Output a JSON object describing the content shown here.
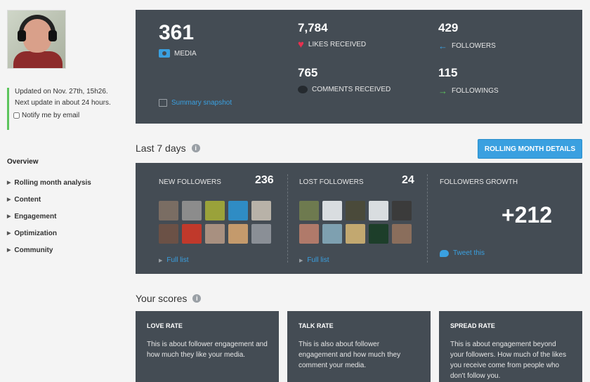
{
  "sidebar": {
    "update_line1": "Updated on Nov. 27th, 15h26.",
    "update_line2": "Next update in about 24 hours.",
    "notify_label": "Notify me by email",
    "overview": "Overview",
    "items": [
      {
        "label": "Rolling month analysis"
      },
      {
        "label": "Content"
      },
      {
        "label": "Engagement"
      },
      {
        "label": "Optimization"
      },
      {
        "label": "Community"
      }
    ]
  },
  "summary": {
    "media_count": "361",
    "media_label": "MEDIA",
    "likes_count": "7,784",
    "likes_label": "LIKES RECEIVED",
    "comments_count": "765",
    "comments_label": "COMMENTS RECEIVED",
    "followers_count": "429",
    "followers_label": "FOLLOWERS",
    "followings_count": "115",
    "followings_label": "FOLLOWINGS",
    "snapshot_link": "Summary snapshot"
  },
  "last7": {
    "title": "Last 7 days",
    "button_label": "ROLLING MONTH DETAILS",
    "new_followers_label": "NEW FOLLOWERS",
    "new_followers_count": "236",
    "lost_followers_label": "LOST FOLLOWERS",
    "lost_followers_count": "24",
    "growth_label": "FOLLOWERS GROWTH",
    "growth_value": "+212",
    "full_list": "Full list",
    "tweet_this": "Tweet this",
    "new_thumbs": [
      "#7a6d63",
      "#8c8c8c",
      "#9aa23a",
      "#2f8cc4",
      "#b8b2a8",
      "#6b5146",
      "#c0392b",
      "#a89080",
      "#c49a6c",
      "#8a8f96"
    ],
    "lost_thumbs": [
      "#6e7a4f",
      "#d9dde0",
      "#4a4a3a",
      "#d9dde0",
      "#3b3b3b",
      "#b07a6a",
      "#7ea0b0",
      "#c2a870",
      "#1d3e2a",
      "#8a6e5c"
    ]
  },
  "scores": {
    "title": "Your scores",
    "cards": [
      {
        "title": "LOVE RATE",
        "desc": "This is about follower engagement and how much they like your media."
      },
      {
        "title": "TALK RATE",
        "desc": "This is also about follower engagement and how much they comment your media."
      },
      {
        "title": "SPREAD RATE",
        "desc": "This is about engagement beyond your followers. How much of the likes you receive come from people who don't follow you."
      }
    ]
  }
}
